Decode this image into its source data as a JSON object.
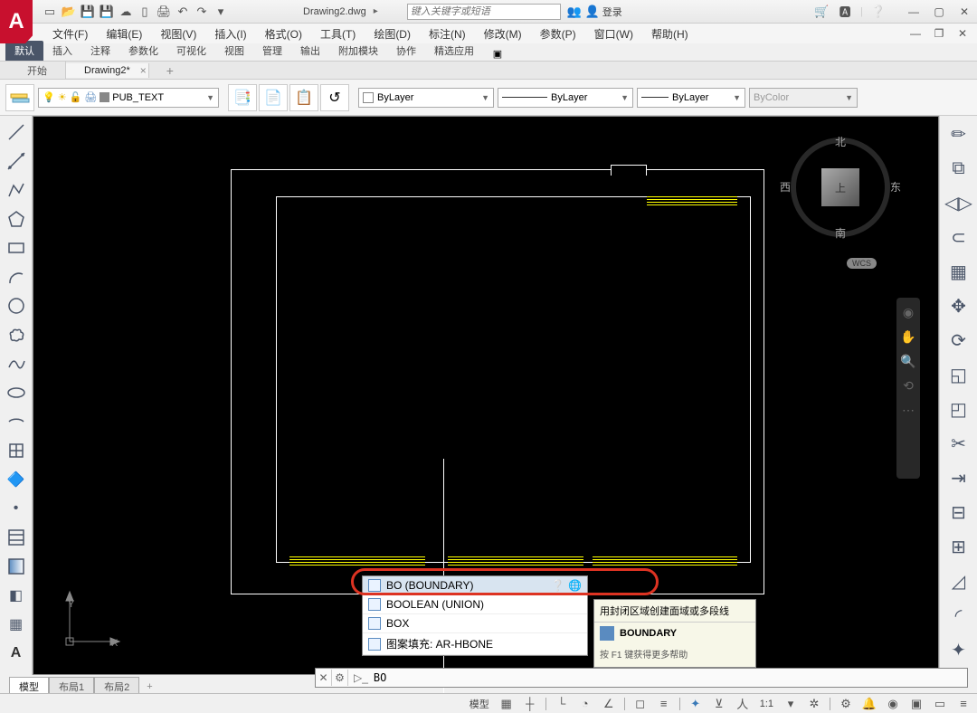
{
  "titlebar": {
    "logo": "A",
    "filename": "Drawing2.dwg",
    "search_placeholder": "键入关键字或短语",
    "login": "登录"
  },
  "menus": [
    "文件(F)",
    "编辑(E)",
    "视图(V)",
    "插入(I)",
    "格式(O)",
    "工具(T)",
    "绘图(D)",
    "标注(N)",
    "修改(M)",
    "参数(P)",
    "窗口(W)",
    "帮助(H)"
  ],
  "ribbon_tabs": [
    "默认",
    "插入",
    "注释",
    "参数化",
    "可视化",
    "视图",
    "管理",
    "输出",
    "附加模块",
    "协作",
    "精选应用"
  ],
  "doc_tabs": {
    "start": "开始",
    "active": "Drawing2*"
  },
  "props": {
    "layer": "PUB_TEXT",
    "color": "ByLayer",
    "linetype": "ByLayer",
    "lineweight": "ByLayer",
    "plotstyle": "ByColor"
  },
  "viewcube": {
    "n": "北",
    "s": "南",
    "e": "东",
    "w": "西",
    "top": "上",
    "wcs": "WCS"
  },
  "ucs": {
    "x": "X",
    "y": "Y"
  },
  "autocomplete": {
    "items": [
      {
        "label": "BO (BOUNDARY)",
        "sel": true
      },
      {
        "label": "BOOLEAN (UNION)"
      },
      {
        "label": "BOX"
      },
      {
        "label": "图案填充: AR-HBONE"
      }
    ]
  },
  "tooltip": {
    "head": "用封闭区域创建面域或多段线",
    "cmd": "BOUNDARY",
    "foot": "按 F1 键获得更多帮助"
  },
  "cmdline": {
    "value": "BO"
  },
  "layout_tabs": [
    "模型",
    "布局1",
    "布局2"
  ],
  "status": {
    "model": "模型",
    "scale": "1:1"
  }
}
